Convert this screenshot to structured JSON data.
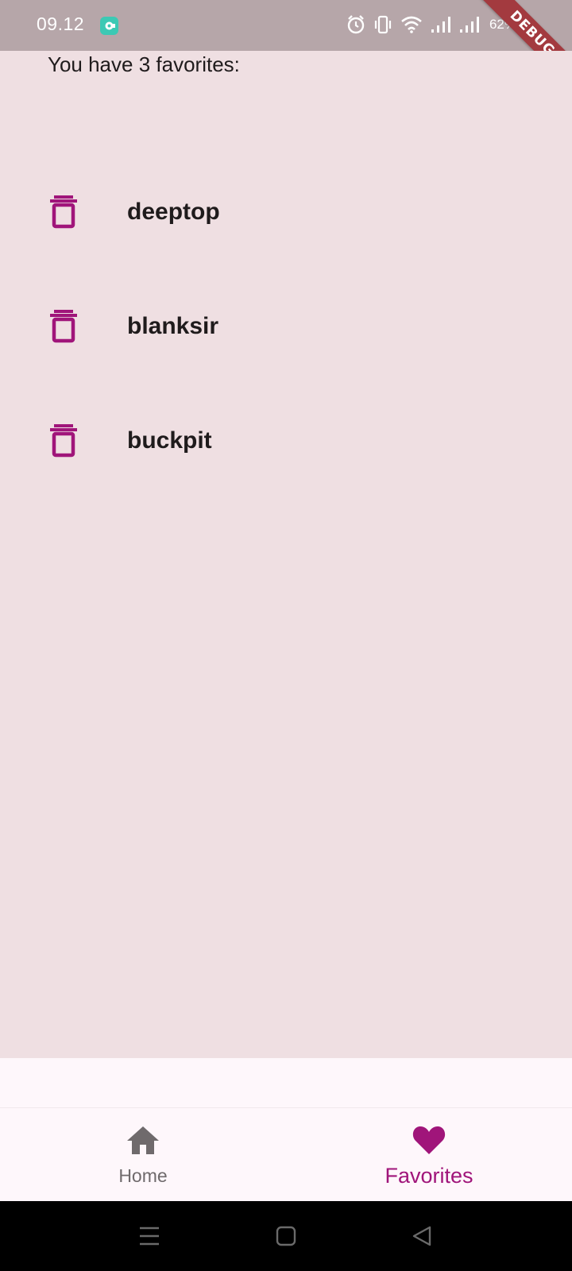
{
  "status_bar": {
    "time": "09.12",
    "battery": "62%",
    "icons": [
      "app-notification-icon",
      "alarm-icon",
      "vibrate-icon",
      "wifi-icon",
      "signal-icon",
      "signal-icon",
      "battery-charging-icon"
    ]
  },
  "debug_banner": "DEBUG",
  "favorites": {
    "count_text": "You have 3 favorites:",
    "items": [
      {
        "name": "deeptop",
        "icon": "delete-icon"
      },
      {
        "name": "blanksir",
        "icon": "delete-icon"
      },
      {
        "name": "buckpit",
        "icon": "delete-icon"
      }
    ]
  },
  "bottom_nav": {
    "home_label": "Home",
    "favorites_label": "Favorites",
    "selected": "Favorites"
  },
  "colors": {
    "accent": "#a0157a",
    "background": "#efdfe2",
    "nav_background": "#fef7fb",
    "status_bar": "#b6a6a9",
    "debug_banner": "#a33a3f"
  }
}
